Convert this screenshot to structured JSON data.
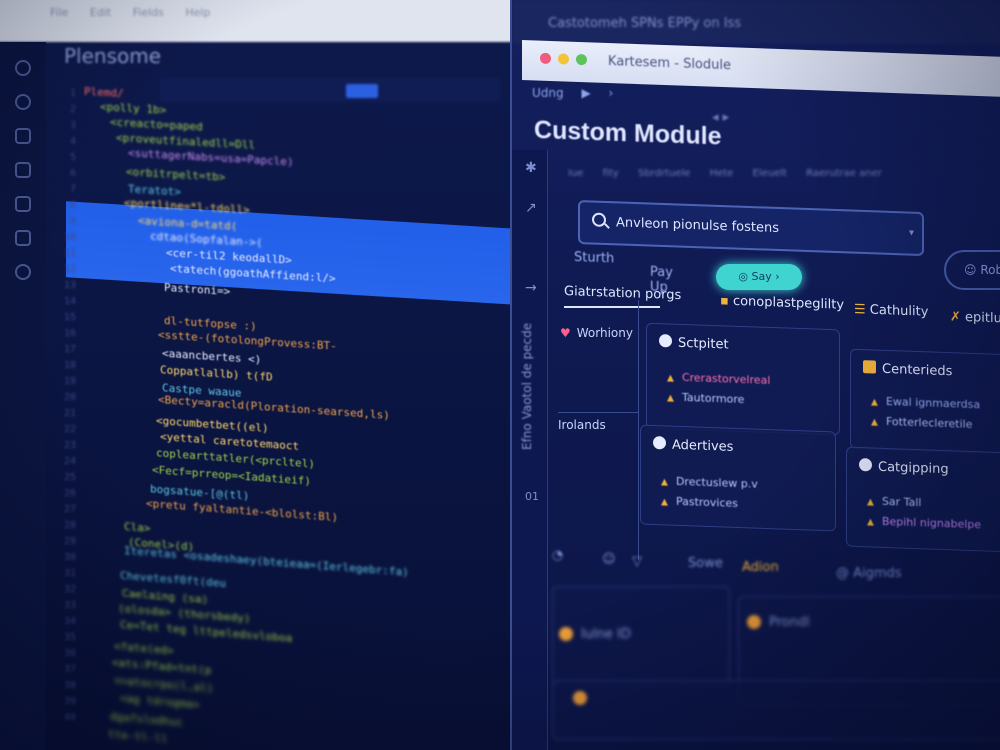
{
  "editor": {
    "title_tabs": [
      "File",
      "Edit",
      "Fields",
      "Help"
    ],
    "tab_label": "Plensome",
    "line_numbers": [
      "1",
      "2",
      "3",
      "4",
      "5",
      "6",
      "7",
      "8",
      "9",
      "10",
      "11",
      "12",
      "13",
      "14",
      "15",
      "16",
      "17",
      "18",
      "19",
      "20",
      "21",
      "22",
      "23",
      "24",
      "25",
      "26",
      "27",
      "28",
      "29",
      "30",
      "31",
      "32",
      "33",
      "34",
      "35",
      "36",
      "37",
      "38",
      "39",
      "40"
    ],
    "code_lines": [
      {
        "text": "Plemd/",
        "cls": "tok-r"
      },
      {
        "text": "<polly 1b>",
        "cls": "tok-g"
      },
      {
        "text": "<creacto=paped",
        "cls": "tok-g"
      },
      {
        "text": "<proveutfinaledll=Dll",
        "cls": "tok-g"
      },
      {
        "text": "<suttagerNabs=usa=Papcle)",
        "cls": "tok-p"
      },
      {
        "text": "<orbitrpelt=tb>",
        "cls": "tok-g"
      },
      {
        "text": "Teratot>",
        "cls": "tok-c"
      },
      {
        "text": "<portline=*l-tdoll>",
        "cls": "tok-y"
      },
      {
        "text": "<aviona-d=tatd(",
        "cls": "tok-y"
      },
      {
        "text": "cdtao(Sopfalan->(",
        "cls": "tok-w"
      },
      {
        "text": "<cer-til2 keodallD>",
        "cls": "tok-w"
      },
      {
        "text": "<tatech(ggoathAffiend:l/>",
        "cls": "tok-w"
      },
      {
        "text": "Pastroni=>",
        "cls": "tok-w"
      },
      {
        "text": "",
        "cls": "tok-w"
      },
      {
        "text": "dl-tutfopse :)",
        "cls": "tok-o"
      },
      {
        "text": "<sstte-(fotolongProvess:BT-",
        "cls": "tok-o"
      },
      {
        "text": "<aaancbertes <)",
        "cls": "tok-w"
      },
      {
        "text": "Coppatlallb) t(fD",
        "cls": "tok-y"
      },
      {
        "text": "Castpe  waaue",
        "cls": "tok-c"
      },
      {
        "text": "<Becty=aracld(Ploration-searsed,ls)",
        "cls": "tok-o"
      },
      {
        "text": "<gocumbetbet((el)",
        "cls": "tok-y"
      },
      {
        "text": "<yettal caretotemaoct",
        "cls": "tok-y"
      },
      {
        "text": "coplearttatler(<prcltel)",
        "cls": "tok-g"
      },
      {
        "text": "<Fecf=prreop=<Iadatieif)",
        "cls": "tok-g"
      },
      {
        "text": "bogsatue-[@(tl)",
        "cls": "tok-c"
      },
      {
        "text": "<pretu fyaltantie-<blolst:Bl)",
        "cls": "tok-o"
      },
      {
        "text": "Cla>",
        "cls": "tok-g"
      },
      {
        "text": "(Conel>(d)",
        "cls": "tok-g"
      },
      {
        "text": "Iteretas <osadeshaey(bteieaa=(Ierlegebr:fa)",
        "cls": "tok-c"
      },
      {
        "text": "Chevetesf0ft(deu",
        "cls": "tok-c"
      },
      {
        "text": "Caelaing (sa)",
        "cls": "tok-g"
      },
      {
        "text": "(olosda> (thorsbedy)",
        "cls": "tok-g"
      },
      {
        "text": "Ce=Tet teg lttpeledsvloboa",
        "cls": "tok-g"
      },
      {
        "text": "<fate(ed>",
        "cls": "tok-g"
      },
      {
        "text": "<ats:Pfad<tnt(p",
        "cls": "tok-g"
      },
      {
        "text": "<>atocrpo(l,al)",
        "cls": "tok-g"
      },
      {
        "text": "<ag tdrogma>",
        "cls": "tok-g"
      },
      {
        "text": "dgafslodhuc",
        "cls": "tok-g"
      },
      {
        "text": "tte-tl-ll",
        "cls": "tok-g"
      }
    ]
  },
  "module": {
    "top_strip": "Castotomeh SPNs  EPPy on Iss",
    "window_title": "Kartesem - Slodule",
    "nav": {
      "back": "Udng",
      "arrow": "▶",
      "arrow2": "›"
    },
    "title": "Custom Module",
    "subtabs": [
      "Iue",
      "fity",
      "Sbrdrtuele",
      "Hete",
      "Eleuelt",
      "Raerutrae aner"
    ],
    "search": {
      "placeholder": "Anvleon pionulse fostens"
    },
    "row_links": [
      "Sturth",
      "Pay Up"
    ],
    "say_pill": "◎ Say ›",
    "side_pill": "☺ Roby",
    "sections": [
      {
        "label": "Giatrstation porgs",
        "color": "#dfe6ff"
      },
      {
        "label": "conoplastpeglilty",
        "color": "#f0b23a"
      },
      {
        "label": "Cathulity",
        "color": "#dfe6ff"
      },
      {
        "label": "epitlunt",
        "color": "#f0b23a"
      }
    ],
    "left_col": {
      "item1": "Worhiony",
      "item2": "Irolands"
    },
    "rail_vertical_text": "Efno Vaotol de pecde",
    "rail_numbers": "01",
    "cards": [
      {
        "title": "Sctpitet",
        "lines": [
          {
            "text": "Crerastorvelreal",
            "cls": "c-pink"
          },
          {
            "text": "Tautormore",
            "cls": "c-light"
          }
        ]
      },
      {
        "title": "Centerieds",
        "lines": [
          {
            "text": "Ewal ignmaerdsa",
            "cls": "c-blue"
          },
          {
            "text": "Fotterlecleretile",
            "cls": "c-light"
          }
        ]
      },
      {
        "title": "Adertives",
        "lines": [
          {
            "text": "Drectuslew p.v",
            "cls": "c-light"
          },
          {
            "text": "Pastrovices",
            "cls": "c-light"
          }
        ]
      },
      {
        "title": "Catgipping",
        "lines": [
          {
            "text": "Sar Tall",
            "cls": "c-light"
          },
          {
            "text": "Bepihl nignabelpe",
            "cls": "c-purple"
          }
        ]
      }
    ],
    "bottom_toolbar": [
      "Sowe",
      "Adion",
      "@ Aigmds"
    ],
    "bottom_panels": {
      "p1": "Iulne ID",
      "p2": "Prondl"
    }
  },
  "colors": {
    "accent_blue": "#2363f2",
    "teal_pill": "#3fd4d0",
    "orange": "#f0a03a",
    "pink": "#ff6fb0"
  },
  "icons": {
    "activity_bar": [
      "explorer-icon",
      "search-icon",
      "source-control-icon",
      "debug-icon",
      "extensions-icon",
      "settings-icon"
    ],
    "rail": [
      "gear-icon",
      "expand-icon"
    ]
  }
}
